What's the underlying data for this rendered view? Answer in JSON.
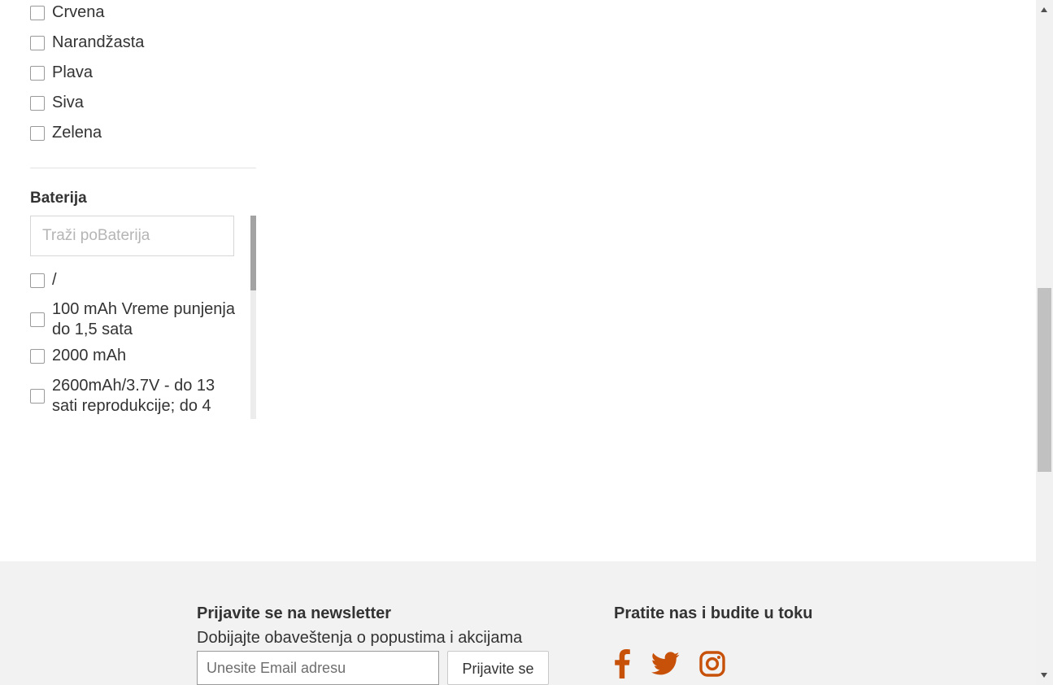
{
  "colors": {
    "accent": "#c8510a",
    "footer_bg": "#f2f2f2",
    "text": "#333333"
  },
  "filters": {
    "color_options": [
      {
        "label": "Crvena",
        "checked": false
      },
      {
        "label": "Narandžasta",
        "checked": false
      },
      {
        "label": "Plava",
        "checked": false
      },
      {
        "label": "Siva",
        "checked": false
      },
      {
        "label": "Zelena",
        "checked": false
      }
    ],
    "battery": {
      "title": "Baterija",
      "search_placeholder": "Traži poBaterija",
      "options": [
        {
          "label": "/",
          "checked": false
        },
        {
          "label": "100 mAh Vreme punjenja do 1,5 sata",
          "checked": false
        },
        {
          "label": "2000 mAh",
          "checked": false
        },
        {
          "label": "2600mAh/3.7V - do 13 sati reprodukcije; do 4",
          "checked": false
        }
      ]
    }
  },
  "footer": {
    "newsletter": {
      "title": "Prijavite se na newsletter",
      "subtitle": "Dobijajte obaveštenja o popustima i akcijama",
      "email_placeholder": "Unesite Email adresu",
      "submit_label": "Prijavite se"
    },
    "social": {
      "title": "Pratite nas i budite u toku",
      "icons": [
        "facebook-icon",
        "twitter-icon",
        "instagram-icon"
      ]
    }
  }
}
